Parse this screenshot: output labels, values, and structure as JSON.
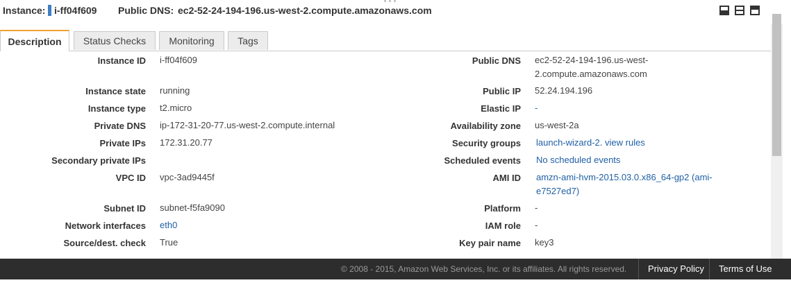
{
  "header": {
    "instance_label": "Instance:",
    "instance_id": "i-ff04f609",
    "dns_label": "Public DNS:",
    "dns_value": "ec2-52-24-194-196.us-west-2.compute.amazonaws.com",
    "icons": [
      "minimize-panel-icon",
      "restore-panel-icon",
      "maximize-panel-icon"
    ]
  },
  "tabs": [
    {
      "label": "Description",
      "active": true
    },
    {
      "label": "Status Checks",
      "active": false
    },
    {
      "label": "Monitoring",
      "active": false
    },
    {
      "label": "Tags",
      "active": false
    }
  ],
  "left_fields": [
    {
      "label": "Instance ID",
      "value": "i-ff04f609"
    },
    {
      "label": "Instance state",
      "value": "running"
    },
    {
      "label": "Instance type",
      "value": "t2.micro"
    },
    {
      "label": "Private DNS",
      "value": "ip-172-31-20-77.us-west-2.compute.internal"
    },
    {
      "label": "Private IPs",
      "value": "172.31.20.77"
    },
    {
      "label": "Secondary private IPs",
      "value": ""
    },
    {
      "label": "VPC ID",
      "value": "vpc-3ad9445f"
    },
    {
      "label": "Subnet ID",
      "value": "subnet-f5fa9090"
    },
    {
      "label": "Network interfaces",
      "value": "eth0"
    },
    {
      "label": "Source/dest. check",
      "value": "True"
    }
  ],
  "right_fields": [
    {
      "label": "Public DNS",
      "value": "ec2-52-24-194-196.us-west-2.compute.amazonaws.com",
      "value_line1": "ec2-52-24-194-196.us-west-",
      "value_line2": "2.compute.amazonaws.com"
    },
    {
      "label": "Public IP",
      "value": "52.24.194.196"
    },
    {
      "label": "Elastic IP",
      "value": "-"
    },
    {
      "label": "Availability zone",
      "value": "us-west-2a"
    },
    {
      "label": "Security groups",
      "value": "launch-wizard-2",
      "separator": ".",
      "extra_link": "view rules"
    },
    {
      "label": "Scheduled events",
      "value": "No scheduled events"
    },
    {
      "label": "AMI ID",
      "value": "amzn-ami-hvm-2015.03.0.x86_64-gp2 (ami-e7527ed7)",
      "value_line1": "amzn-ami-hvm-2015.03.0.x86_64-gp2 (ami-",
      "value_line2": "e7527ed7)"
    },
    {
      "label": "Platform",
      "value": "-"
    },
    {
      "label": "IAM role",
      "value": "-"
    },
    {
      "label": "Key pair name",
      "value": "key3"
    }
  ],
  "footer": {
    "copyright": "© 2008 - 2015, Amazon Web Services, Inc. or its affiliates. All rights reserved.",
    "privacy": "Privacy Policy",
    "terms": "Terms of Use"
  },
  "colors": {
    "accent_tab": "#f0a030",
    "link": "#1f5fa5",
    "footer_bg": "#2d2d2d",
    "marker": "#3c7fc2"
  }
}
